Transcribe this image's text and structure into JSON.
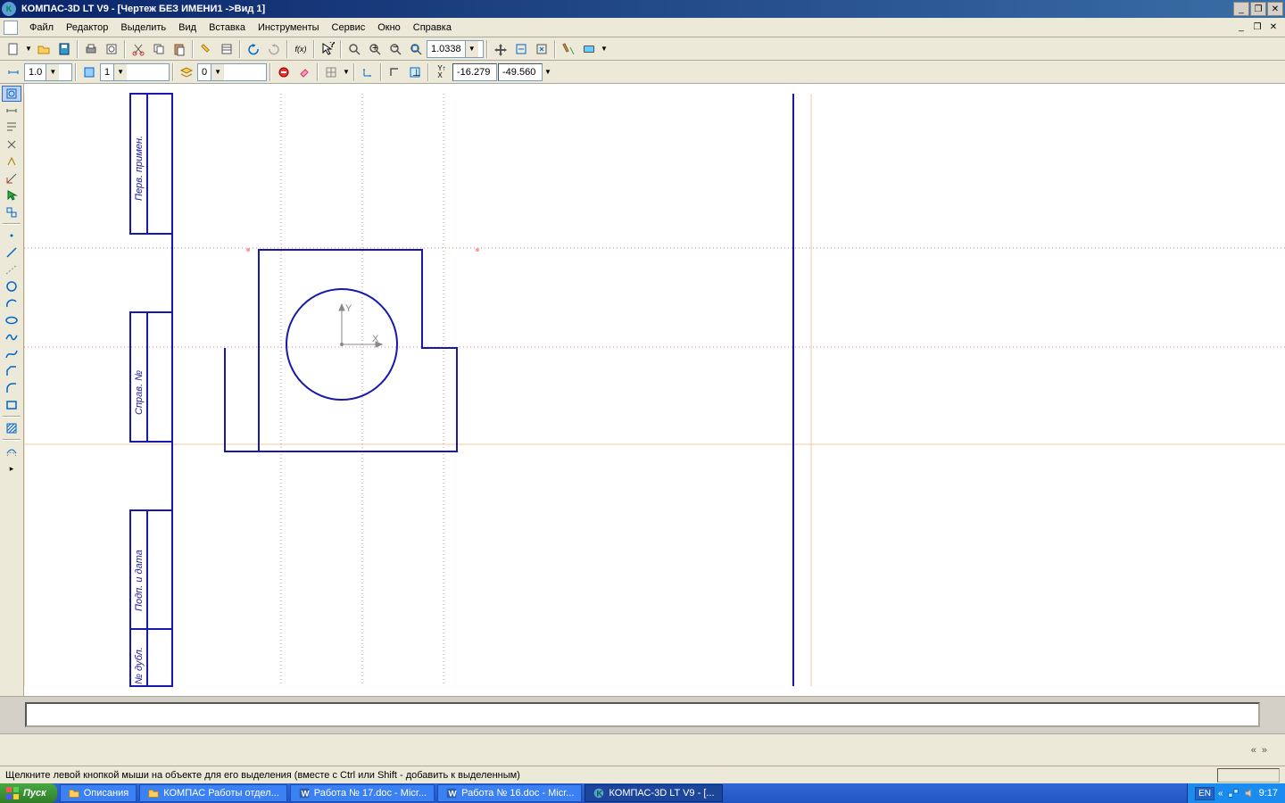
{
  "title": "КОМПАС-3D LT V9 - [Чертеж БЕЗ ИМЕНИ1 ->Вид 1]",
  "menu": {
    "items": [
      "Файл",
      "Редактор",
      "Выделить",
      "Вид",
      "Вставка",
      "Инструменты",
      "Сервис",
      "Окно",
      "Справка"
    ]
  },
  "toolbar1": {
    "zoom_value": "1.0338"
  },
  "toolbar2": {
    "step_value": "1.0",
    "view_value": "1",
    "layer_value": "0",
    "coord_x": "-16.279",
    "coord_y": "-49.560"
  },
  "axis_labels": {
    "x": "X",
    "y": "Y"
  },
  "status_hint": "Щелкните левой кнопкой мыши на объекте для его выделения (вместе с Ctrl или Shift - добавить к выделенным)",
  "taskbar": {
    "start": "Пуск",
    "tasks": [
      {
        "label": "Описания",
        "type": "folder"
      },
      {
        "label": "КОМПАС Работы отдел...",
        "type": "folder"
      },
      {
        "label": "Работа № 17.doc - Micr...",
        "type": "word"
      },
      {
        "label": "Работа № 16.doc - Micr...",
        "type": "word"
      },
      {
        "label": "КОМПАС-3D LT V9 - [...",
        "type": "app",
        "active": true
      }
    ],
    "lang": "EN",
    "clock": "9:17"
  }
}
